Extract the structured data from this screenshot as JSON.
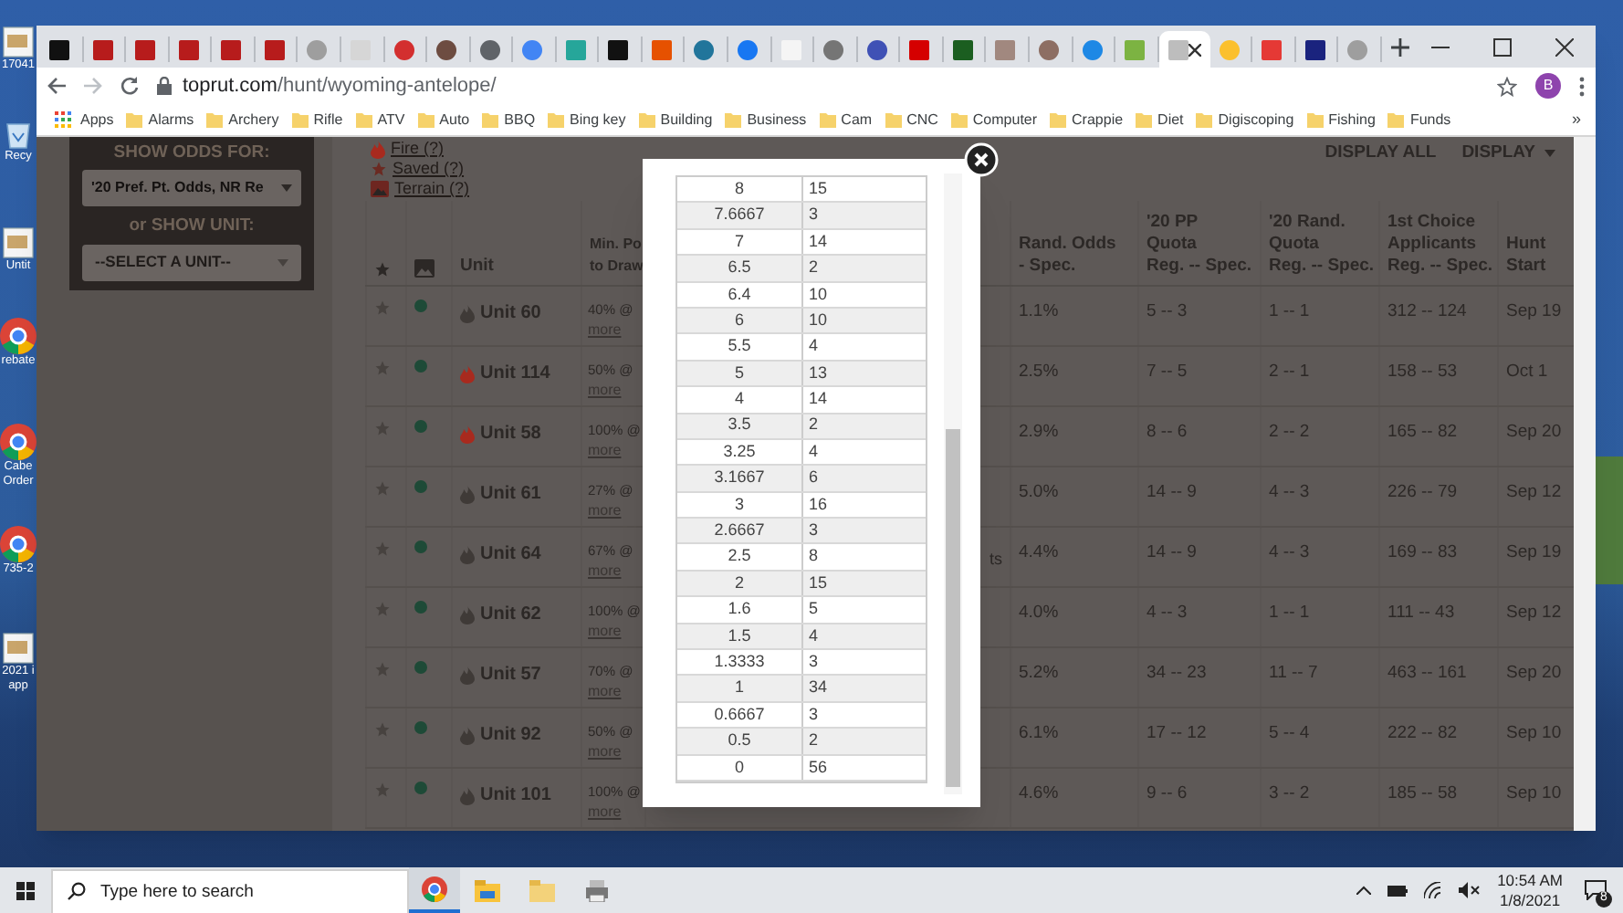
{
  "desktop": {
    "icons": [
      {
        "kind": "document",
        "lines": [
          "17041"
        ]
      },
      {
        "kind": "recycle-bin",
        "lines": [
          "Recy"
        ]
      },
      {
        "kind": "document",
        "lines": [
          "Untit"
        ]
      },
      {
        "kind": "chrome",
        "lines": [
          "rebate"
        ]
      },
      {
        "kind": "chrome",
        "lines": [
          "Cabe",
          "Order"
        ]
      },
      {
        "kind": "chrome",
        "lines": [
          "735-2"
        ]
      },
      {
        "kind": "document",
        "lines": [
          "2021 i",
          "app"
        ]
      }
    ]
  },
  "browser": {
    "tabs": [
      {
        "kind": "square",
        "color": "#111111",
        "selected": false
      },
      {
        "kind": "square",
        "color": "#b71c1c",
        "selected": false
      },
      {
        "kind": "square",
        "color": "#b71c1c",
        "selected": false
      },
      {
        "kind": "square",
        "color": "#b71c1c",
        "selected": false
      },
      {
        "kind": "square",
        "color": "#b71c1c",
        "selected": false
      },
      {
        "kind": "square",
        "color": "#b71c1c",
        "selected": false
      },
      {
        "kind": "circle",
        "color": "#9e9e9e",
        "selected": false
      },
      {
        "kind": "square",
        "color": "#d6d6d6",
        "selected": false
      },
      {
        "kind": "circle",
        "color": "#d32f2f",
        "selected": false
      },
      {
        "kind": "circle",
        "color": "#6d4c41",
        "selected": false
      },
      {
        "kind": "circle",
        "color": "#5f6368",
        "selected": false
      },
      {
        "kind": "circle",
        "color": "#4285f4",
        "selected": false
      },
      {
        "kind": "square",
        "color": "#26a69a",
        "selected": false
      },
      {
        "kind": "square",
        "color": "#111111",
        "selected": false
      },
      {
        "kind": "square",
        "color": "#e65100",
        "selected": false
      },
      {
        "kind": "circle",
        "color": "#21759b",
        "selected": false
      },
      {
        "kind": "circle",
        "color": "#1877f2",
        "selected": false
      },
      {
        "kind": "square",
        "color": "#f5f5f5",
        "selected": false
      },
      {
        "kind": "circle",
        "color": "#757575",
        "selected": false
      },
      {
        "kind": "circle",
        "color": "#3f51b5",
        "selected": false
      },
      {
        "kind": "square",
        "color": "#d50000",
        "selected": false
      },
      {
        "kind": "square",
        "color": "#1b5e20",
        "selected": false
      },
      {
        "kind": "square",
        "color": "#a1887f",
        "selected": false
      },
      {
        "kind": "circle",
        "color": "#8d6e63",
        "selected": false
      },
      {
        "kind": "circle",
        "color": "#1e88e5",
        "selected": false
      },
      {
        "kind": "square",
        "color": "#7cb342",
        "selected": false
      },
      {
        "kind": "square",
        "color": "#bdbdbd",
        "selected": true
      },
      {
        "kind": "circle",
        "color": "#fbc02d",
        "selected": false
      },
      {
        "kind": "square",
        "color": "#e53935",
        "selected": false
      },
      {
        "kind": "square",
        "color": "#1a237e",
        "selected": false
      },
      {
        "kind": "circle",
        "color": "#9e9e9e",
        "selected": false
      }
    ],
    "address_bar": {
      "host": "toprut.com",
      "path": "/hunt/wyoming-antelope/",
      "profile_initial": "B"
    },
    "bookmarks": {
      "apps_label": "Apps",
      "folders": [
        "Alarms",
        "Archery",
        "Rifle",
        "ATV",
        "Auto",
        "BBQ",
        "Bing key",
        "Building",
        "Business",
        "Cam",
        "CNC",
        "Computer",
        "Crappie",
        "Diet",
        "Digiscoping",
        "Fishing",
        "Funds"
      ],
      "overflow": "»"
    }
  },
  "page": {
    "sidebar": {
      "odds_label": "SHOW ODDS FOR:",
      "odds_value": "'20 Pref. Pt. Odds, NR Re",
      "unit_label": "or SHOW UNIT:",
      "unit_value": "--SELECT A UNIT--"
    },
    "legend": [
      {
        "kind": "fire",
        "label": "Fire (?)"
      },
      {
        "kind": "star",
        "label": "Saved (?)"
      },
      {
        "kind": "terrain",
        "label": "Terrain (?)"
      }
    ],
    "display_buttons": [
      {
        "label": "DISPLAY ALL",
        "dropdown": false
      },
      {
        "label": "DISPLAY",
        "dropdown": true
      }
    ],
    "table": {
      "columns": [
        {
          "kind": "star"
        },
        {
          "kind": "picture"
        },
        {
          "kind": "text",
          "lines": [
            "Unit"
          ]
        },
        {
          "kind": "text",
          "lines": [
            "Min. Po",
            "to Draw"
          ]
        },
        {
          "kind": "gap"
        },
        {
          "kind": "text",
          "lines": [
            "Rand. Odds",
            "- Spec."
          ]
        },
        {
          "kind": "text",
          "lines": [
            "'20 PP",
            "Quota",
            "Reg. -- Spec."
          ]
        },
        {
          "kind": "text",
          "lines": [
            "'20 Rand.",
            "Quota",
            "Reg. -- Spec."
          ]
        },
        {
          "kind": "text",
          "lines": [
            "1st Choice",
            "Applicants",
            "Reg. -- Spec."
          ]
        },
        {
          "kind": "text",
          "lines": [
            "Hunt",
            "Start"
          ]
        }
      ],
      "rows": [
        {
          "fire": false,
          "unit": "Unit 60",
          "min_points": "40% @",
          "more": "more",
          "rand_odds": "1.1%",
          "pp_quota": "5 -- 3",
          "rand_quota": "1 -- 1",
          "applicants": "312 -- 124",
          "hunt_start": "Sep 19"
        },
        {
          "fire": true,
          "unit": "Unit 114",
          "min_points": "50% @",
          "more": "more",
          "rand_odds": "2.5%",
          "pp_quota": "7 -- 5",
          "rand_quota": "2 -- 1",
          "applicants": "158 -- 53",
          "hunt_start": "Oct 1"
        },
        {
          "fire": true,
          "unit": "Unit 58",
          "min_points": "100% @",
          "more": "more",
          "rand_odds": "2.9%",
          "pp_quota": "8 -- 6",
          "rand_quota": "2 -- 2",
          "applicants": "165 -- 82",
          "hunt_start": "Sep 20"
        },
        {
          "fire": false,
          "unit": "Unit 61",
          "min_points": "27% @",
          "more": "more",
          "rand_odds": "5.0%",
          "pp_quota": "14 -- 9",
          "rand_quota": "4 -- 3",
          "applicants": "226 -- 79",
          "hunt_start": "Sep 12"
        },
        {
          "fire": false,
          "unit": "Unit 64",
          "min_points": "67% @",
          "more": "more",
          "column_5": "ts",
          "rand_odds": "4.4%",
          "pp_quota": "14 -- 9",
          "rand_quota": "4 -- 3",
          "applicants": "169 -- 83",
          "hunt_start": "Sep 19"
        },
        {
          "fire": false,
          "unit": "Unit 62",
          "min_points": "100% @",
          "more": "more",
          "rand_odds": "4.0%",
          "pp_quota": "4 -- 3",
          "rand_quota": "1 -- 1",
          "applicants": "111 -- 43",
          "hunt_start": "Sep 12"
        },
        {
          "fire": false,
          "unit": "Unit 57",
          "min_points": "70% @",
          "more": "more",
          "rand_odds": "5.2%",
          "pp_quota": "34 -- 23",
          "rand_quota": "11 -- 7",
          "applicants": "463 -- 161",
          "hunt_start": "Sep 20"
        },
        {
          "fire": false,
          "unit": "Unit 92",
          "min_points": "50% @",
          "more": "more",
          "rand_odds": "6.1%",
          "pp_quota": "17 -- 12",
          "rand_quota": "5 -- 4",
          "applicants": "222 -- 82",
          "hunt_start": "Sep 10"
        },
        {
          "fire": false,
          "unit": "Unit 101",
          "min_points": "100% @",
          "more": "more",
          "rand_odds": "4.6%",
          "pp_quota": "9 -- 6",
          "rand_quota": "3 -- 2",
          "applicants": "185 -- 58",
          "hunt_start": "Sep 10"
        }
      ]
    },
    "modal": {
      "rows": [
        [
          "8",
          "15"
        ],
        [
          "7.6667",
          "3"
        ],
        [
          "7",
          "14"
        ],
        [
          "6.5",
          "2"
        ],
        [
          "6.4",
          "10"
        ],
        [
          "6",
          "10"
        ],
        [
          "5.5",
          "4"
        ],
        [
          "5",
          "13"
        ],
        [
          "4",
          "14"
        ],
        [
          "3.5",
          "2"
        ],
        [
          "3.25",
          "4"
        ],
        [
          "3.1667",
          "6"
        ],
        [
          "3",
          "16"
        ],
        [
          "2.6667",
          "3"
        ],
        [
          "2.5",
          "8"
        ],
        [
          "2",
          "15"
        ],
        [
          "1.6",
          "5"
        ],
        [
          "1.5",
          "4"
        ],
        [
          "1.3333",
          "3"
        ],
        [
          "1",
          "34"
        ],
        [
          "0.6667",
          "3"
        ],
        [
          "0.5",
          "2"
        ],
        [
          "0",
          "56"
        ]
      ]
    }
  },
  "taskbar": {
    "search_placeholder": "Type here to search",
    "time": "10:54 AM",
    "date": "1/8/2021",
    "notification_count": "8"
  }
}
